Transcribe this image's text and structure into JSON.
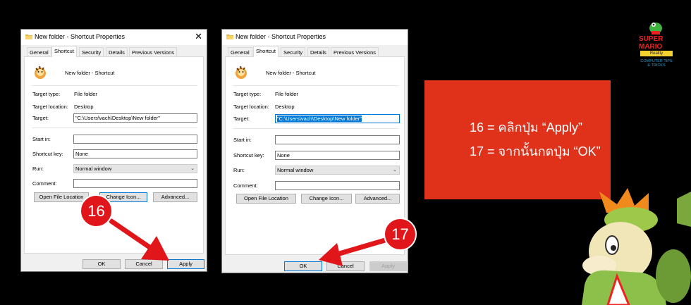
{
  "dialogs": [
    {
      "title": "New folder - Shortcut Properties",
      "close_glyph": "✕",
      "tabs": [
        "General",
        "Shortcut",
        "Security",
        "Details",
        "Previous Versions"
      ],
      "active_tab": "Shortcut",
      "shortcut_name": "New folder - Shortcut",
      "target_type_label": "Target type:",
      "target_type_value": "File folder",
      "target_location_label": "Target location:",
      "target_location_value": "Desktop",
      "target_label": "Target:",
      "target_value": "\"C:\\Users\\vach\\Desktop\\New folder\"",
      "start_in_label": "Start in:",
      "start_in_value": "",
      "shortcut_key_label": "Shortcut key:",
      "shortcut_key_value": "None",
      "run_label": "Run:",
      "run_value": "Normal window",
      "comment_label": "Comment:",
      "comment_value": "",
      "open_file_location": "Open File Location",
      "change_icon": "Change Icon...",
      "advanced": "Advanced...",
      "ok": "OK",
      "cancel": "Cancel",
      "apply": "Apply"
    },
    {
      "title": "New folder - Shortcut Properties",
      "close_glyph": "✕",
      "tabs": [
        "General",
        "Shortcut",
        "Security",
        "Details",
        "Previous Versions"
      ],
      "active_tab": "Shortcut",
      "shortcut_name": "New folder - Shortcut",
      "target_type_label": "Target type:",
      "target_type_value": "File folder",
      "target_location_label": "Target location:",
      "target_location_value": "Desktop",
      "target_label": "Target:",
      "target_value": "\"C:\\Users\\vach\\Desktop\\New folder\"",
      "start_in_label": "Start in:",
      "start_in_value": "",
      "shortcut_key_label": "Shortcut key:",
      "shortcut_key_value": "None",
      "run_label": "Run:",
      "run_value": "Normal window",
      "comment_label": "Comment:",
      "comment_value": "",
      "open_file_location": "Open File Location",
      "change_icon": "Change Icon...",
      "advanced": "Advanced...",
      "ok": "OK",
      "cancel": "Cancel",
      "apply": "Apply"
    }
  ],
  "step_markers": {
    "first": "16",
    "second": "17"
  },
  "instructions": {
    "line1": "16 = คลิกปุ่ม “Apply”",
    "line2": "17 = จากนั้นกดปุ่ม “OK”"
  },
  "logo": {
    "line1": "SUPER MARIO",
    "line2": "Reality",
    "line3": "COMPUTER TIPS & TRICKS"
  },
  "colors": {
    "background": "#000000",
    "marker_red": "#e0161b",
    "instruction_box": "#e0311b",
    "selection_blue": "#0078d7"
  }
}
